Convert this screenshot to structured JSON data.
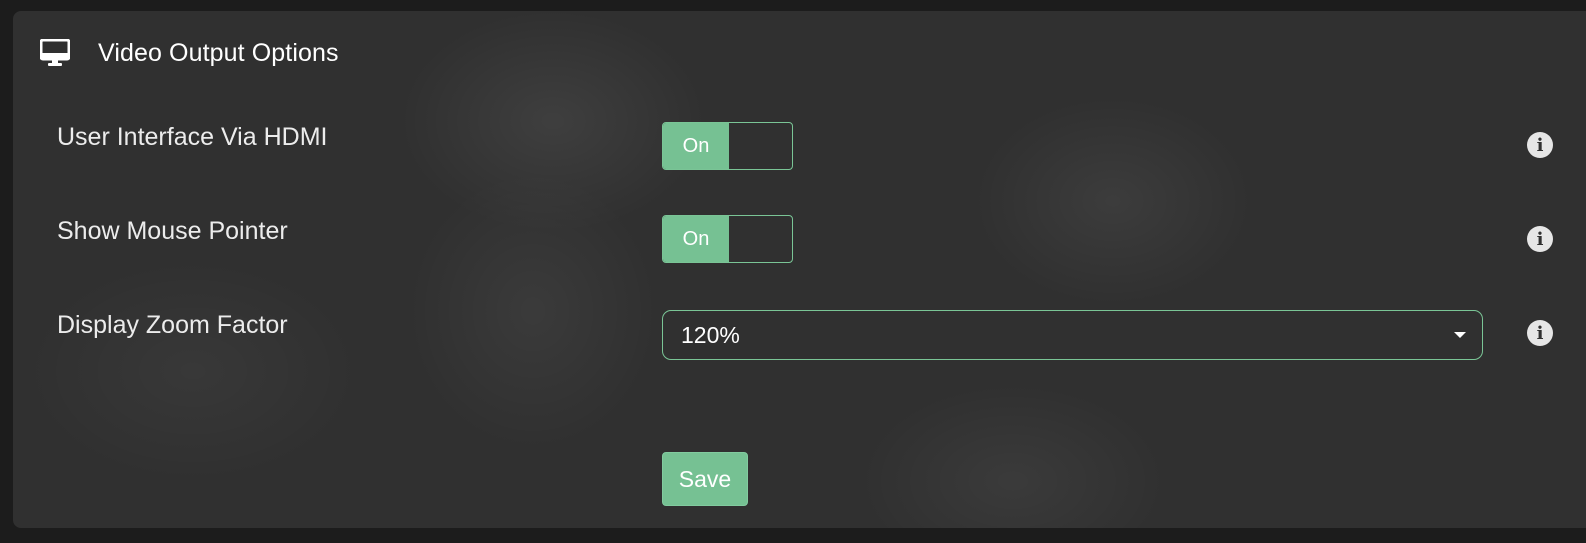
{
  "panel": {
    "title": "Video Output Options",
    "title_icon": "monitor-icon"
  },
  "settings": [
    {
      "label": "User Interface Via HDMI",
      "control": "toggle",
      "value": "On",
      "info_icon": "info-icon"
    },
    {
      "label": "Show Mouse Pointer",
      "control": "toggle",
      "value": "On",
      "info_icon": "info-icon"
    },
    {
      "label": "Display Zoom Factor",
      "control": "select",
      "value": "120%",
      "info_icon": "info-icon"
    }
  ],
  "actions": {
    "save_label": "Save"
  },
  "colors": {
    "accent": "#76c193",
    "panel_bg": "#303030",
    "page_bg": "#1c1c1c",
    "text": "#ffffff"
  }
}
